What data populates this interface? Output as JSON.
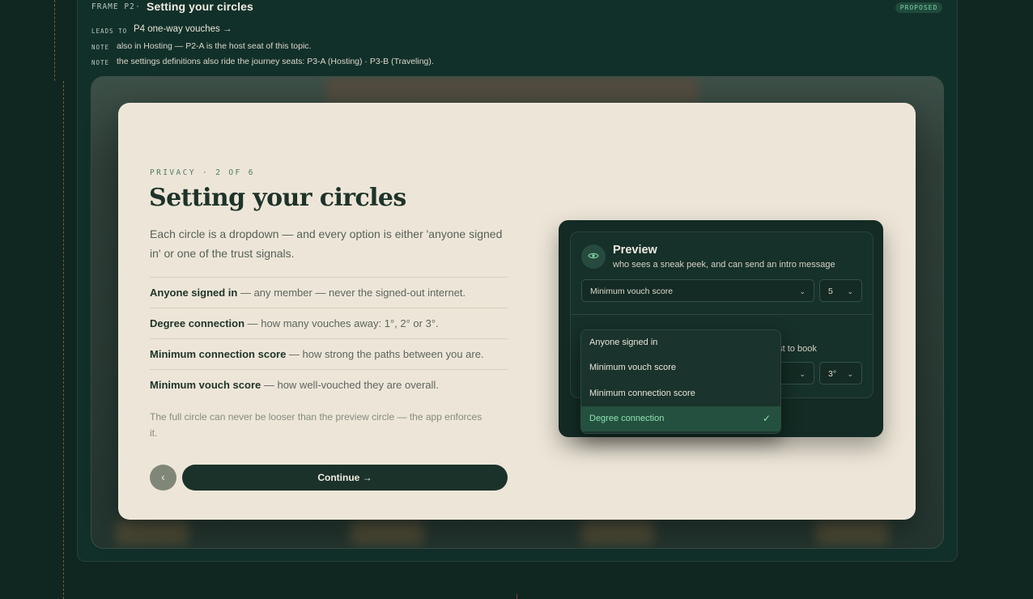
{
  "frame": {
    "label": "FRAME P2",
    "dot": "·",
    "title": "Setting your circles",
    "badge": "PROPOSED",
    "leads_key": "LEADS TO",
    "leads_value": "P4 one-way vouches →",
    "notes": [
      {
        "key": "NOTE",
        "text": "also in Hosting — P2-A is the host seat of this topic."
      },
      {
        "key": "NOTE",
        "text": "the settings definitions also ride the journey seats: P3-A (Hosting) · P3-B (Traveling)."
      }
    ]
  },
  "card": {
    "eyebrow": "PRIVACY · 2 OF 6",
    "heading": "Setting your circles",
    "lead": "Each circle is a dropdown — and every option is either 'anyone signed in' or one of the trust signals.",
    "definitions": [
      {
        "term": "Anyone signed in",
        "desc": " — any member — never the signed-out internet."
      },
      {
        "term": "Degree connection",
        "desc": " — how many vouches away: 1°, 2° or 3°."
      },
      {
        "term": "Minimum connection score",
        "desc": " — how strong the paths between you are."
      },
      {
        "term": "Minimum vouch score",
        "desc": " — how well-vouched they are overall."
      }
    ],
    "footnote": "The full circle can never be looser than the preview circle — the app enforces it.",
    "back_label": "‹",
    "continue_label": "Continue →"
  },
  "panel": {
    "preview": {
      "title": "Preview",
      "desc": "who sees a sneak peek, and can send an intro message",
      "select_value": "Minimum vouch score",
      "threshold_value": "5"
    },
    "full": {
      "desc_fragment": "est to book",
      "threshold_value": "3°"
    }
  },
  "menu": {
    "options": [
      "Anyone signed in",
      "Minimum vouch score",
      "Minimum connection score",
      "Degree connection"
    ],
    "selected": "Degree connection"
  }
}
